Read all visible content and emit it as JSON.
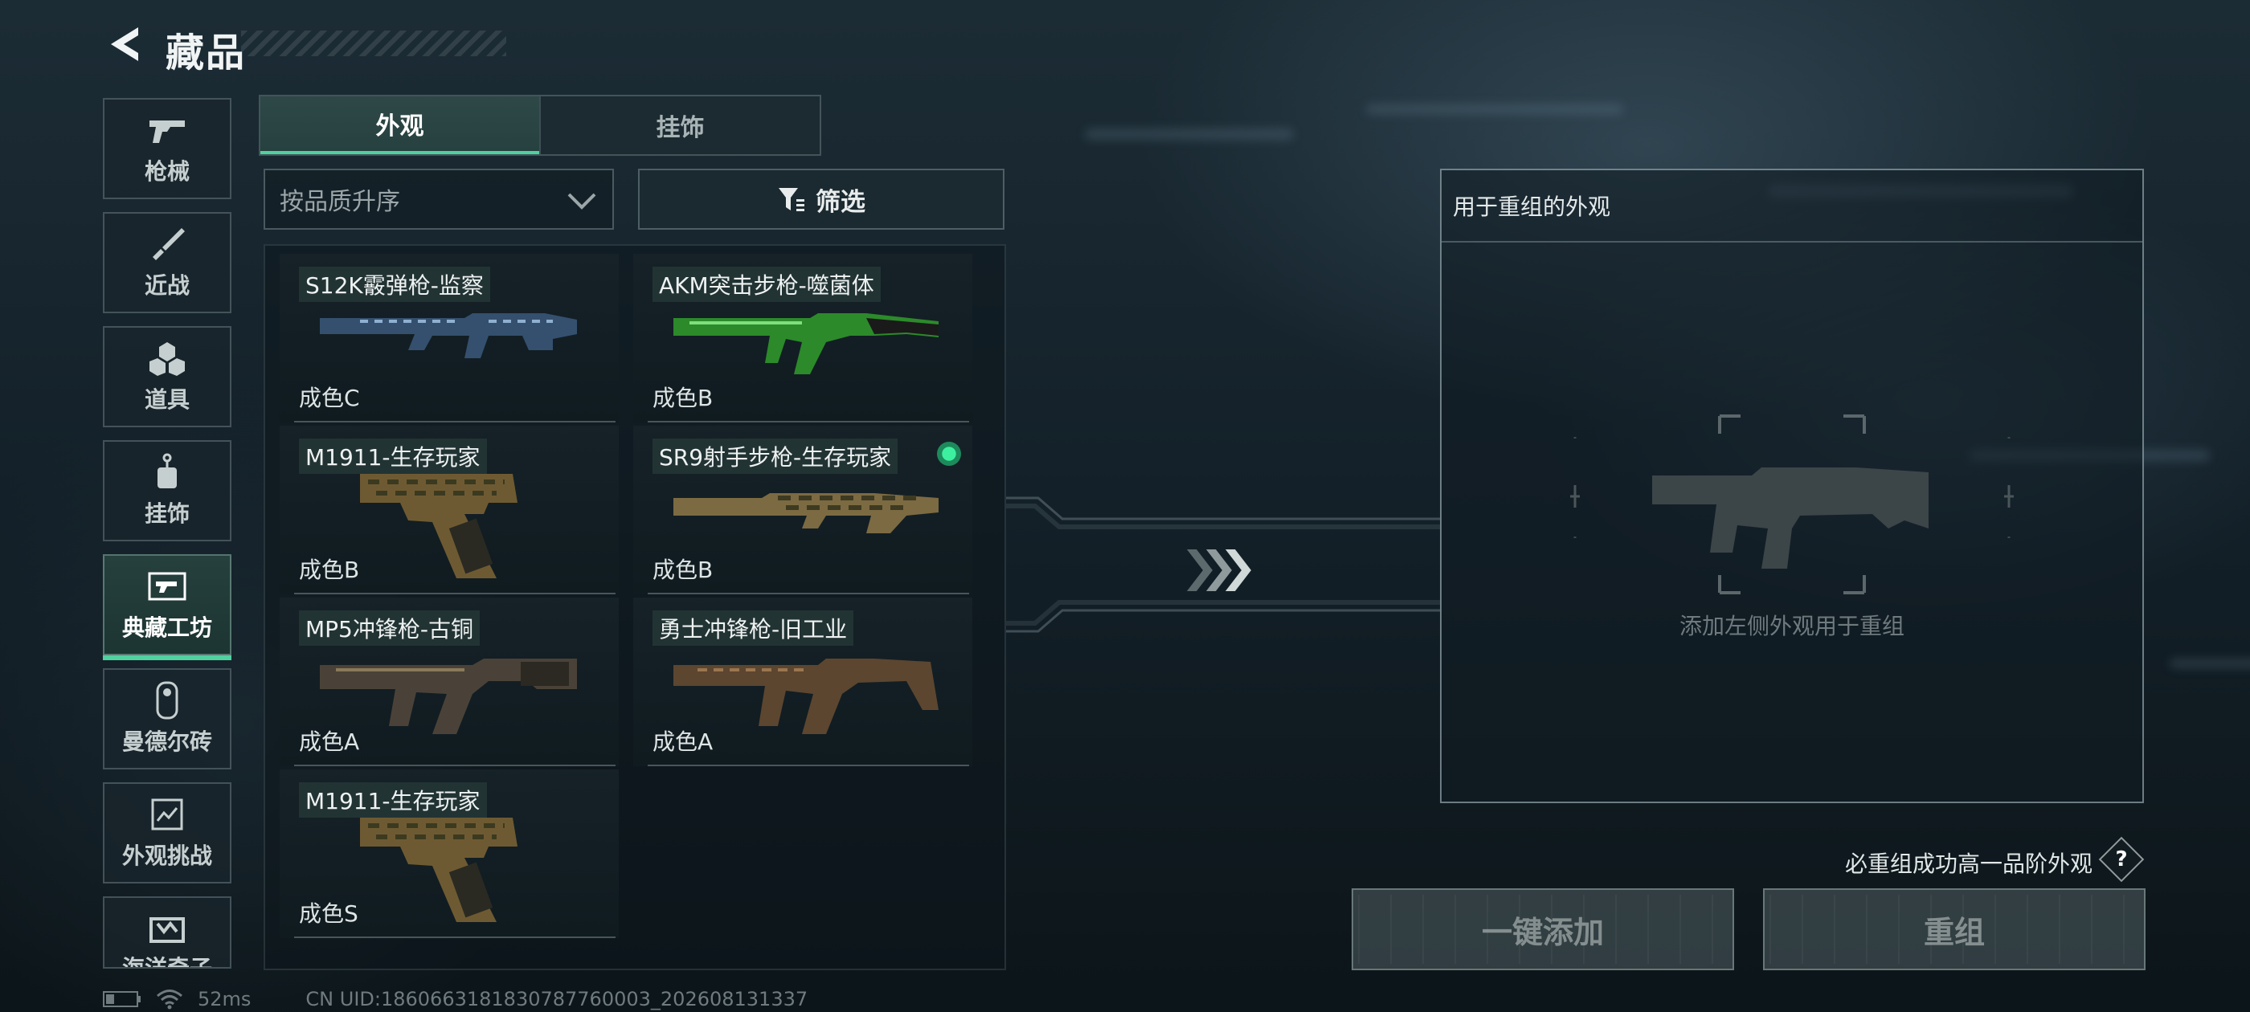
{
  "header": {
    "title": "藏品"
  },
  "sidebar": {
    "items": [
      {
        "label": "枪械",
        "icon": "gun-icon"
      },
      {
        "label": "近战",
        "icon": "knife-icon"
      },
      {
        "label": "道具",
        "icon": "items-icon"
      },
      {
        "label": "挂饰",
        "icon": "charm-icon"
      },
      {
        "label": "典藏工坊",
        "icon": "workshop-icon",
        "active": true
      },
      {
        "label": "曼德尔砖",
        "icon": "brick-icon"
      },
      {
        "label": "外观挑战",
        "icon": "challenge-icon"
      },
      {
        "label": "海洋奇子",
        "icon": "ocean-icon"
      }
    ]
  },
  "tabs": [
    {
      "label": "外观",
      "active": true
    },
    {
      "label": "挂饰",
      "active": false
    }
  ],
  "sort": {
    "value": "按品质升序"
  },
  "filter": {
    "label": "筛选"
  },
  "items": [
    {
      "name": "S12K霰弹枪-监察",
      "grade": "成色C",
      "skin": "blue-camo"
    },
    {
      "name": "AKM突击步枪-噬菌体",
      "grade": "成色B",
      "skin": "green"
    },
    {
      "name": "M1911-生存玩家",
      "grade": "成色B",
      "skin": "woodland"
    },
    {
      "name": "SR9射手步枪-生存玩家",
      "grade": "成色B",
      "skin": "woodland",
      "selected": true
    },
    {
      "name": "MP5冲锋枪-古铜",
      "grade": "成色A",
      "skin": "bronze"
    },
    {
      "name": "勇士冲锋枪-旧工业",
      "grade": "成色A",
      "skin": "rust"
    },
    {
      "name": "M1911-生存玩家",
      "grade": "成色S",
      "skin": "woodland"
    }
  ],
  "recombine_panel": {
    "title": "用于重组的外观",
    "hint": "添加左侧外观用于重组"
  },
  "guarantee_text": "必重组成功高一品阶外观",
  "help_label": "?",
  "buttons": {
    "add_all": "一键添加",
    "recombine": "重组"
  },
  "footer": {
    "ping": "52ms",
    "uid": "CN UID:1860663181830787760003_202608131337"
  },
  "colors": {
    "accent": "#4fd1a0",
    "selected_dot": "#3df0a0"
  }
}
